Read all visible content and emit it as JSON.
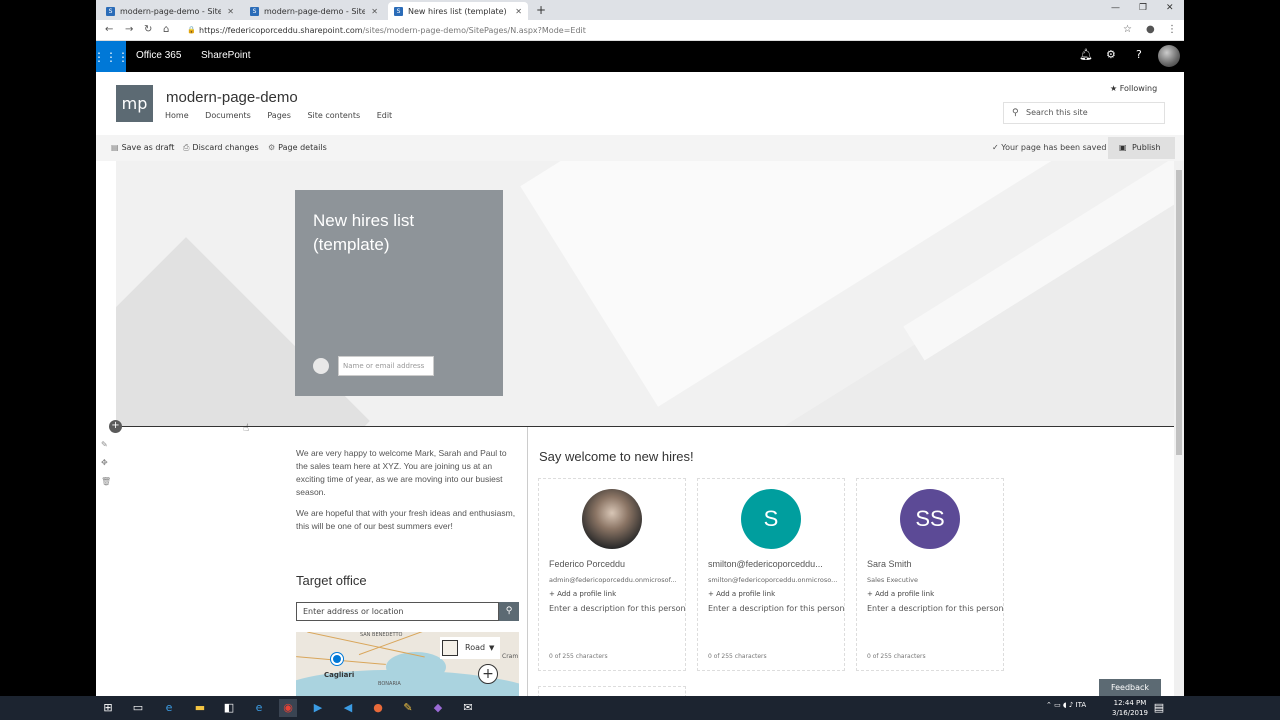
{
  "browser": {
    "tabs": [
      {
        "title": "modern-page-demo - Site Pages",
        "icon": "sharepoint-icon"
      },
      {
        "title": "modern-page-demo - Site Pages",
        "icon": "sharepoint-icon"
      },
      {
        "title": "New hires list (template)",
        "icon": "sharepoint-icon"
      }
    ],
    "url_host": "https://federicoporceddu.sharepoint.com",
    "url_path": "/sites/modern-page-demo/SitePages/N.aspx?Mode=Edit"
  },
  "suite": {
    "app": "Office 365",
    "product": "SharePoint"
  },
  "site": {
    "logo": "mp",
    "title": "modern-page-demo",
    "nav": [
      "Home",
      "Documents",
      "Pages",
      "Site contents",
      "Edit"
    ],
    "following": "Following",
    "search_placeholder": "Search this site"
  },
  "commands": {
    "save_draft": "Save as draft",
    "discard": "Discard changes",
    "details": "Page details",
    "saved": "Your page has been saved",
    "publish": "Publish"
  },
  "hero": {
    "title_line1": "New hires list",
    "title_line2": "(template)",
    "author_placeholder": "Name or email address"
  },
  "text": {
    "p1": "We are very happy to welcome Mark, Sarah and Paul to the sales team here at XYZ. You are joining us at an exciting time of year, as we are moving into our busiest season.",
    "p2": "We are hopeful that with your fresh ideas and enthusiasm, this will be one of our best summers ever!"
  },
  "map": {
    "title": "Target office",
    "placeholder": "Enter address or location",
    "city": "Cagliari",
    "label_north": "SAN BENEDETTO",
    "label_south": "BONARIA",
    "label_east": "Cram",
    "style": "Road"
  },
  "people": {
    "title": "Say welcome to new hires!",
    "add_link": "Add a profile link",
    "desc_placeholder": "Enter a description for this person",
    "counter": "0 of 255 characters",
    "items": [
      {
        "initials": "",
        "name": "Federico Porceddu",
        "sub": "admin@federicoporceddu.onmicrosof...",
        "color": "#444444"
      },
      {
        "initials": "S",
        "name": "smilton@federicoporceddu...",
        "sub": "smilton@federicoporceddu.onmicroso...",
        "color": "#009e9e"
      },
      {
        "initials": "SS",
        "name": "Sara Smith",
        "sub": "Sales Executive",
        "color": "#5c4a96"
      }
    ]
  },
  "feedback": "Feedback",
  "clock": {
    "time": "12:44 PM",
    "date": "3/16/2019"
  },
  "tray_lang": "ITA"
}
